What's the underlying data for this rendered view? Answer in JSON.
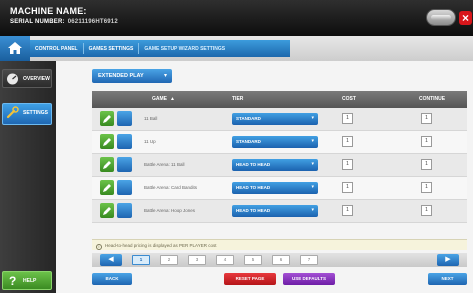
{
  "header": {
    "machine_name_label": "MACHINE NAME:",
    "serial_label": "SERIAL NUMBER:",
    "serial_value": "06211196HT6912",
    "close_label": "×",
    "colors": {
      "bar": "#1a1a1a",
      "close": "#d8161b"
    }
  },
  "breadcrumb": {
    "home_icon": "home-icon",
    "items": [
      "CONTROL PANEL",
      "GAMES SETTINGS",
      "GAME SETUP WIZARD SETTINGS"
    ]
  },
  "sidebar": {
    "items": [
      {
        "label": "OVERVIEW",
        "icon": "gauge-icon",
        "active": false
      },
      {
        "label": "SETTINGS",
        "icon": "wrench-icon",
        "active": true
      },
      {
        "label": "HELP",
        "icon": "question-icon",
        "active": false
      }
    ]
  },
  "main": {
    "subtab": {
      "label": "EXTENDED PLAY",
      "icon": "chevron-down-icon"
    },
    "columns": {
      "game": "GAME",
      "game_sort": "▲",
      "tier": "TIER",
      "cost": "COST",
      "coin": "CONTINUE"
    },
    "rows": [
      {
        "game": "11 Ball",
        "tier": "STANDARD",
        "cost": "1",
        "coin": "1"
      },
      {
        "game": "11 Up",
        "tier": "STANDARD",
        "cost": "1",
        "coin": "1"
      },
      {
        "game": "Battle Arena: 11 Ball",
        "tier": "HEAD TO HEAD",
        "cost": "1",
        "coin": "1"
      },
      {
        "game": "Battle Arena: Card Bandits",
        "tier": "HEAD TO HEAD",
        "cost": "1",
        "coin": "1"
      },
      {
        "game": "Battle Arena: Hoop Jones",
        "tier": "HEAD TO HEAD",
        "cost": "1",
        "coin": "1"
      }
    ],
    "note": "Head-to-head pricing is displayed as PER PLAYER cost",
    "pager": {
      "prev": "◀",
      "next": "▶",
      "pages": [
        "1",
        "2",
        "3",
        "4",
        "5",
        "6",
        "7"
      ],
      "current": "1"
    },
    "buttons": {
      "back": "BACK",
      "reset": "RESET PAGE",
      "defaults": "USE DEFAULTS",
      "next": "NEXT"
    },
    "colors": {
      "accent": "#2a7cc7",
      "reset": "#d42126",
      "defaults": "#8a35c0",
      "help": "#52a832"
    }
  }
}
